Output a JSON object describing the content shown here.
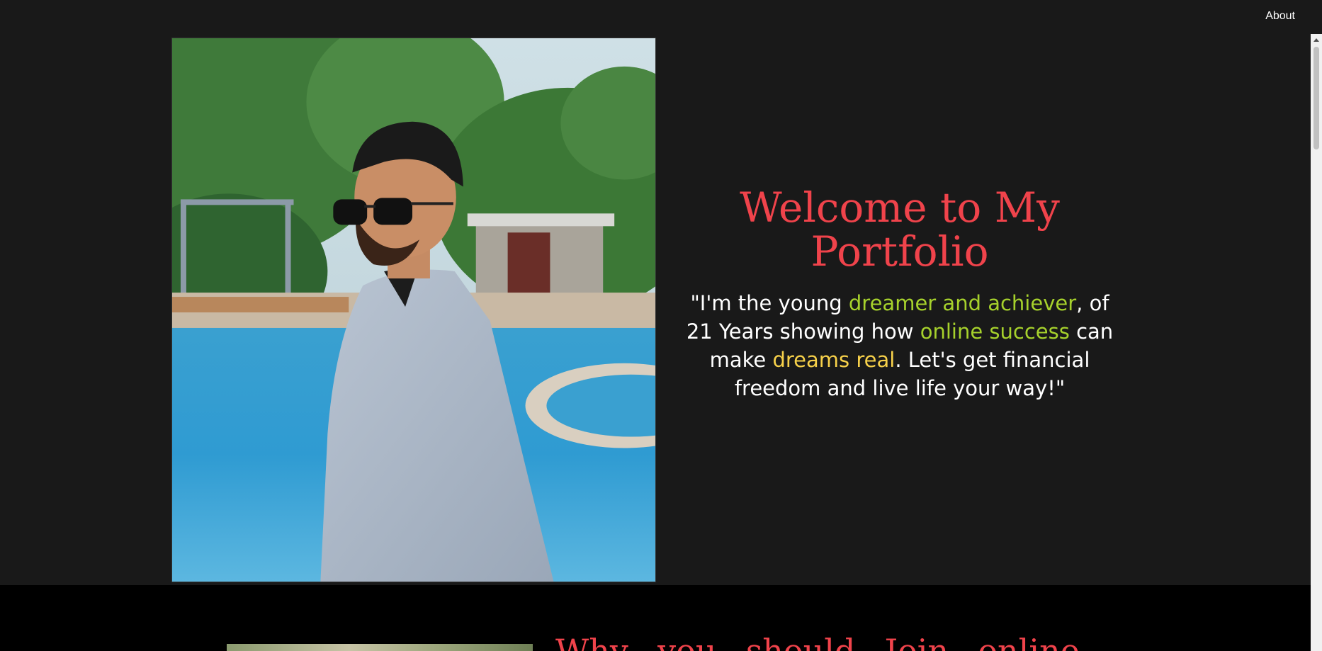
{
  "nav": {
    "about_label": "About"
  },
  "hero": {
    "title": "Welcome to My Portfolio",
    "quote": {
      "p1": "\"I'm the young ",
      "h1": "dreamer and achiever",
      "p2": ", of 21 Years showing how ",
      "h2": "online success",
      "p3": " can make ",
      "h3": "dreams real",
      "p4": ". Let's get financial freedom and live life your way!\""
    },
    "photo_alt": "portrait-photo"
  },
  "section2": {
    "title_words": [
      "Why",
      "you",
      "should",
      "Join",
      "online"
    ]
  },
  "colors": {
    "background": "#191919",
    "accent_red": "#f0434b",
    "highlight_green": "#a6d12c",
    "highlight_yellow": "#f7d14a"
  }
}
